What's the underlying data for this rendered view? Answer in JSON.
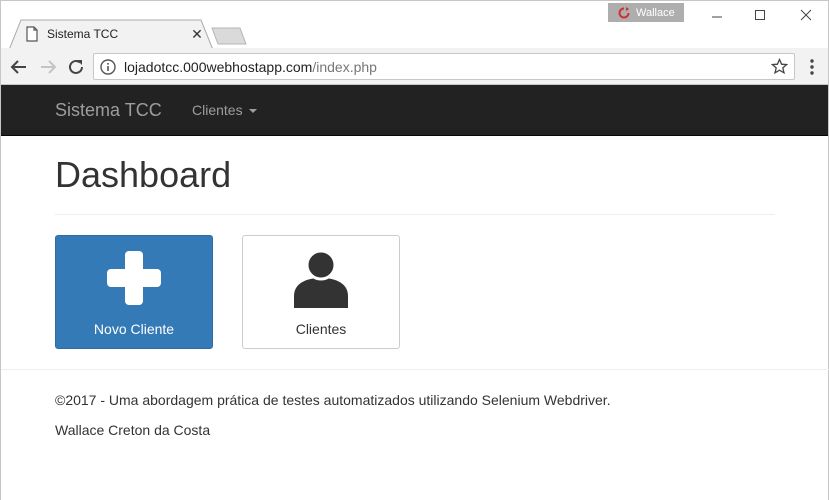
{
  "browser": {
    "tab_title": "Sistema TCC",
    "profile_name": "Wallace",
    "url_host": "lojadotcc.000webhostapp.com",
    "url_path": "/index.php"
  },
  "navbar": {
    "brand": "Sistema TCC",
    "menu_label": "Clientes"
  },
  "main": {
    "title": "Dashboard",
    "tiles": [
      {
        "label": "Novo Cliente",
        "icon": "plus-icon",
        "color": "#337ab7"
      },
      {
        "label": "Clientes",
        "icon": "user-icon",
        "color": "#ffffff"
      }
    ]
  },
  "footer": {
    "line1": "©2017 - Uma abordagem prática de testes automatizados utilizando Selenium Webdriver.",
    "line2": "Wallace Creton da Costa"
  },
  "colors": {
    "navbar_bg": "#222222",
    "primary": "#337ab7"
  }
}
